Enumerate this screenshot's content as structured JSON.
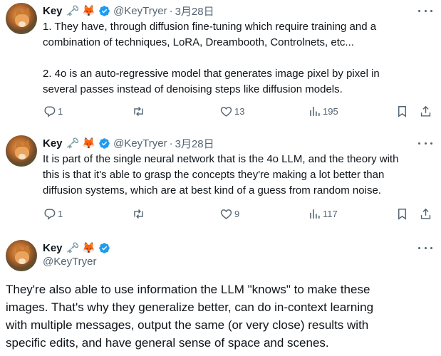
{
  "tweets": [
    {
      "name": "Key",
      "emoji": "🗝️ 🦊",
      "handle": "@KeyTryer",
      "separator": "·",
      "date": "3月28日",
      "lines": [
        "1. They have, through diffusion fine-tuning which require training and a",
        "combination of techniques, LoRA, Dreambooth, Controlnets, etc...",
        "",
        "2. 4o is an auto-regressive model that generates image pixel by pixel in",
        "several passes instead of denoising steps like diffusion models."
      ],
      "replies": "1",
      "retweets": "",
      "likes": "13",
      "views": "195"
    },
    {
      "name": "Key",
      "emoji": "🗝️ 🦊",
      "handle": "@KeyTryer",
      "separator": "·",
      "date": "3月28日",
      "lines": [
        "It is part of the single neural network that is the 4o LLM, and the theory with",
        "this is that it's able to grasp the concepts they're making a lot better than",
        "diffusion systems, which are at best kind of a guess from random noise."
      ],
      "replies": "1",
      "retweets": "",
      "likes": "9",
      "views": "117"
    },
    {
      "name": "Key",
      "emoji": "🗝️ 🦊",
      "handle": "@KeyTryer",
      "lines": [
        "They're also able to use information the LLM \"knows\" to make these",
        "images. That's why they generalize better, can do in-context learning",
        "with multiple messages, output the same (or very close) results with",
        "specific edits, and have general sense of space and scenes."
      ]
    }
  ],
  "colors": {
    "verified": "#1d9bf0",
    "muted": "#536471",
    "text": "#0f1419"
  },
  "icons": [
    "reply-icon",
    "retweet-icon",
    "like-icon",
    "views-icon",
    "bookmark-icon",
    "share-icon",
    "more-icon",
    "verified-badge-icon"
  ]
}
